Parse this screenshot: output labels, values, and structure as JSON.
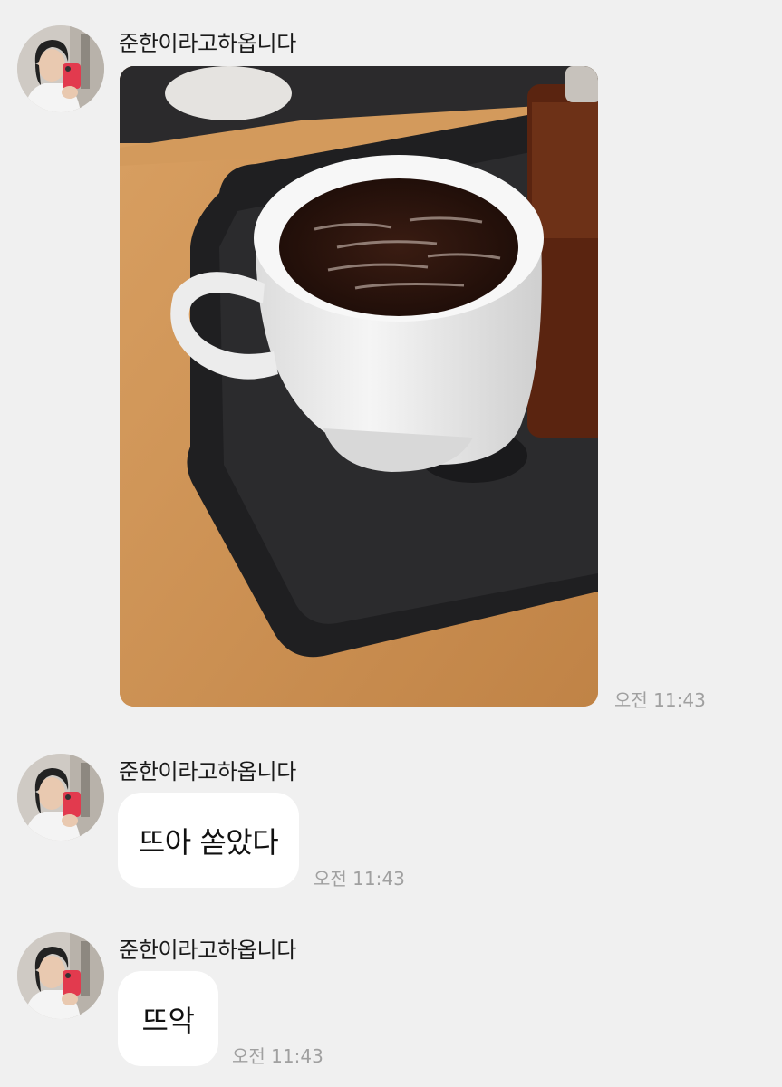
{
  "messages": [
    {
      "sender": "준한이라고하옵니다",
      "type": "image",
      "image_alt": "",
      "time": "오전 11:43"
    },
    {
      "sender": "준한이라고하옵니다",
      "type": "text",
      "text": "뜨아 쏟았다",
      "time": "오전 11:43"
    },
    {
      "sender": "준한이라고하옵니다",
      "type": "text",
      "text": "뜨악",
      "time": "오전 11:43"
    }
  ],
  "colors": {
    "background": "#f0f0f0",
    "bubble": "#ffffff",
    "timestamp": "#a0a0a0"
  }
}
